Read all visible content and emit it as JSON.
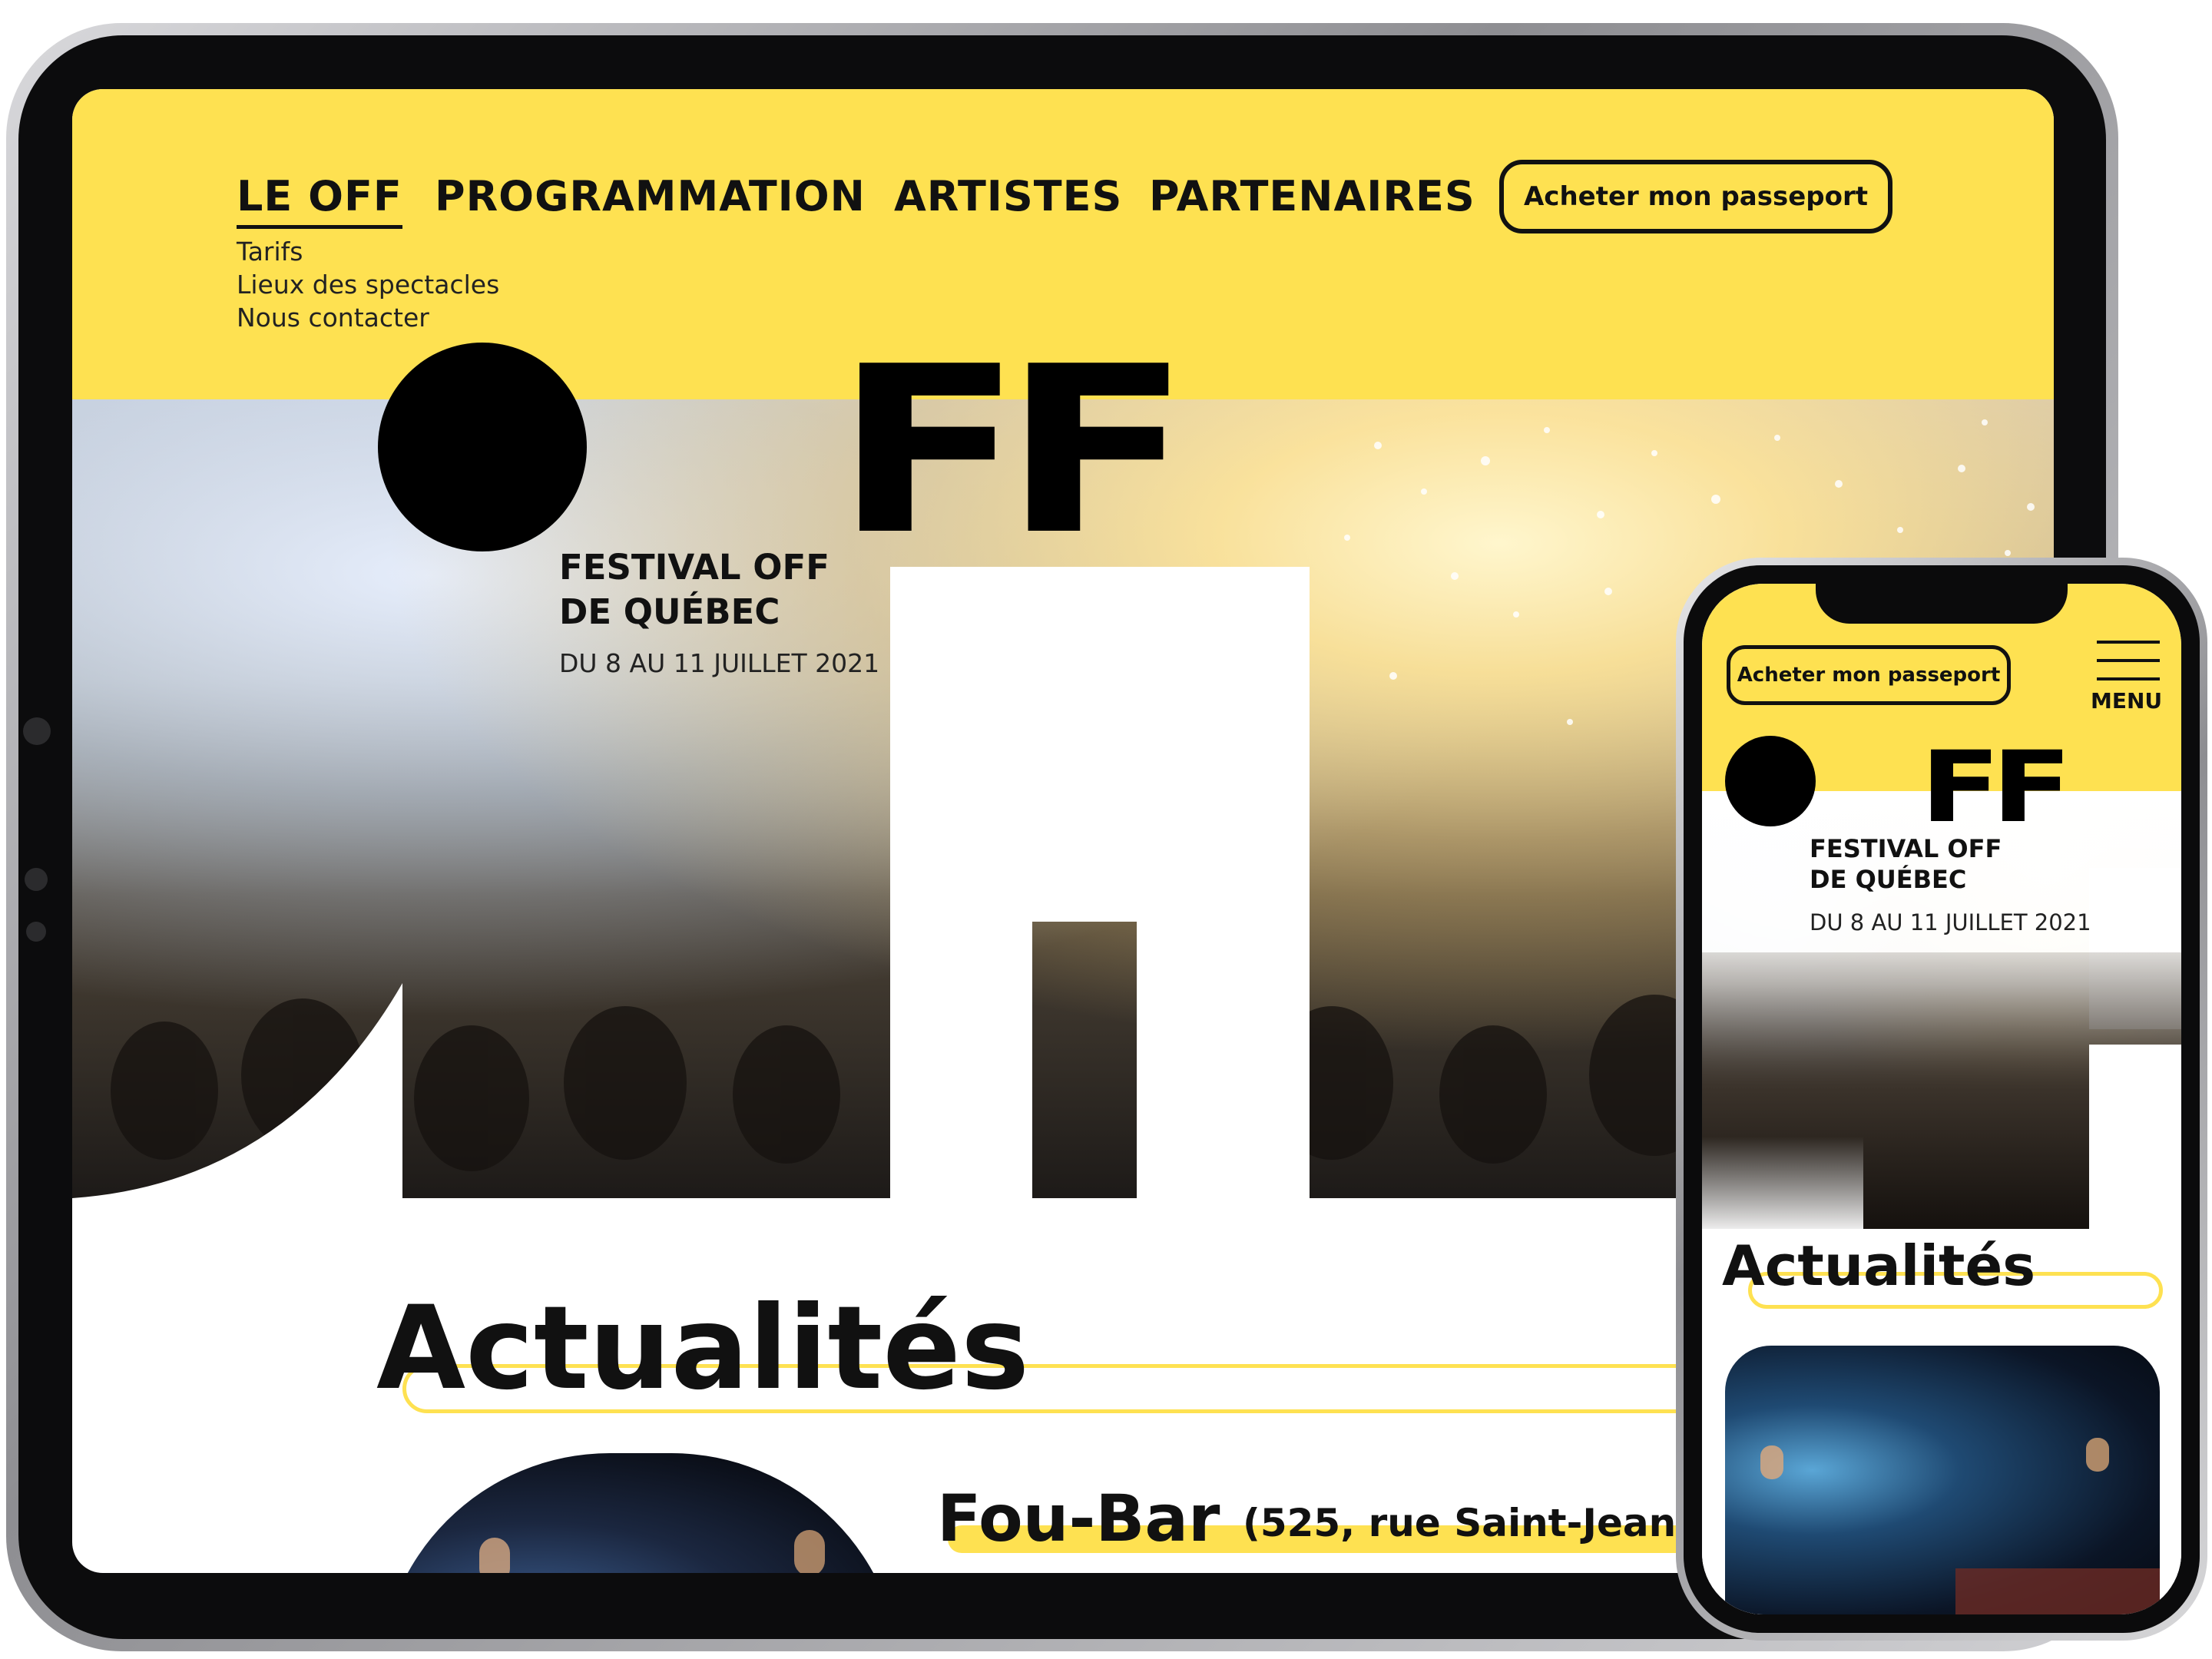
{
  "tablet": {
    "nav": {
      "items": [
        "LE OFF",
        "PROGRAMMATION",
        "ARTISTES",
        "PARTENAIRES"
      ],
      "cta": "Acheter mon passeport",
      "submenu": [
        "Tarifs",
        "Lieux des spectacles",
        "Nous contacter"
      ]
    },
    "hero": {
      "logo_text": "FF",
      "title_line1": "FESTIVAL OFF",
      "title_line2": "DE QUÉBEC",
      "dates": "DU 8 AU 11 JUILLET 2021"
    },
    "news": {
      "heading": "Actualités",
      "item_title": "Fou-Bar",
      "item_address": "(525, rue Saint-Jean)"
    }
  },
  "phone": {
    "cta": "Acheter mon passeport",
    "menu_label": "MENU",
    "hero": {
      "logo_text": "FF",
      "title_line1": "FESTIVAL OFF",
      "title_line2": "DE QUÉBEC",
      "dates": "DU 8 AU 11 JUILLET 2021"
    },
    "news": {
      "heading": "Actualités"
    }
  },
  "colors": {
    "brand_yellow": "#fee151",
    "ink": "#111111"
  },
  "icons": [
    "hamburger-menu-icon"
  ]
}
